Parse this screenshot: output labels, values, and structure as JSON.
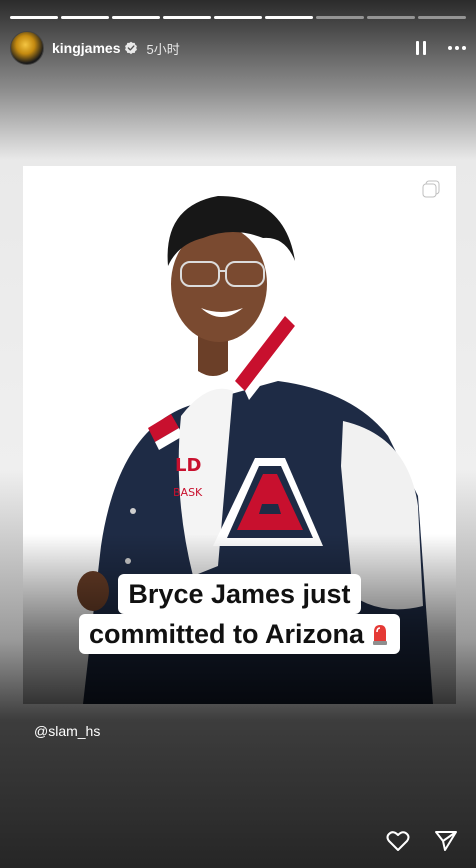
{
  "story": {
    "segments_total": 9,
    "segments_done": 6
  },
  "header": {
    "username": "kingjames",
    "time": "5小时"
  },
  "post": {
    "caption_line1": "Bryce James just",
    "caption_line2": "committed to Arizona"
  },
  "mention": "@slam_hs",
  "colors": {
    "jacket_navy": "#1e2b45",
    "arizona_red": "#c8102e",
    "white": "#ffffff"
  },
  "icons": [
    "verified-badge-icon",
    "pause-icon",
    "more-icon",
    "multi-image-icon",
    "siren-icon",
    "heart-icon",
    "send-icon"
  ]
}
